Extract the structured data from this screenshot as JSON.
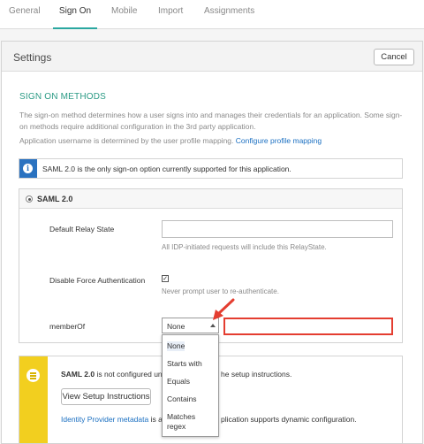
{
  "tabs": [
    {
      "label": "General"
    },
    {
      "label": "Sign On"
    },
    {
      "label": "Mobile"
    },
    {
      "label": "Import"
    },
    {
      "label": "Assignments"
    }
  ],
  "settings": {
    "title": "Settings",
    "cancel_label": "Cancel"
  },
  "sign_on_methods": {
    "heading": "SIGN ON METHODS",
    "desc_line1": "The sign-on method determines how a user signs into and manages their credentials for an application. Some sign-",
    "desc_line2": "on methods require additional configuration in the 3rd party application.",
    "username_text": "Application username is determined by the user profile mapping.",
    "configure_link": "Configure profile mapping"
  },
  "info_banner": {
    "text": "SAML 2.0 is the only sign-on option currently supported for this application."
  },
  "saml": {
    "label": "SAML 2.0",
    "relay_label": "Default Relay State",
    "relay_value": "",
    "relay_hint": "All IDP-initiated requests will include this RelayState.",
    "force_auth_label": "Disable Force Authentication",
    "force_auth_checked": true,
    "force_auth_hint": "Never prompt user to re-authenticate.",
    "memberof_label": "memberOf",
    "memberof_selected": "None",
    "memberof_value": ""
  },
  "dropdown": {
    "options": [
      "None",
      "Starts with",
      "Equals",
      "Contains",
      "Matches\nregex"
    ]
  },
  "setup_card": {
    "line1_bold": "SAML 2.0",
    "line1_a": " is not configured unt",
    "line1_b": "he setup instructions.",
    "button_label": "View Setup Instructions",
    "metadata_link": "Identity Provider metadata",
    "line3_a": " is a",
    "line3_b": "plication supports dynamic configuration."
  },
  "colors": {
    "accent_teal": "#2aa7a0",
    "info_blue": "#2a72c0",
    "highlight_red": "#e43d30",
    "warning_yellow": "#f2cf1f"
  }
}
